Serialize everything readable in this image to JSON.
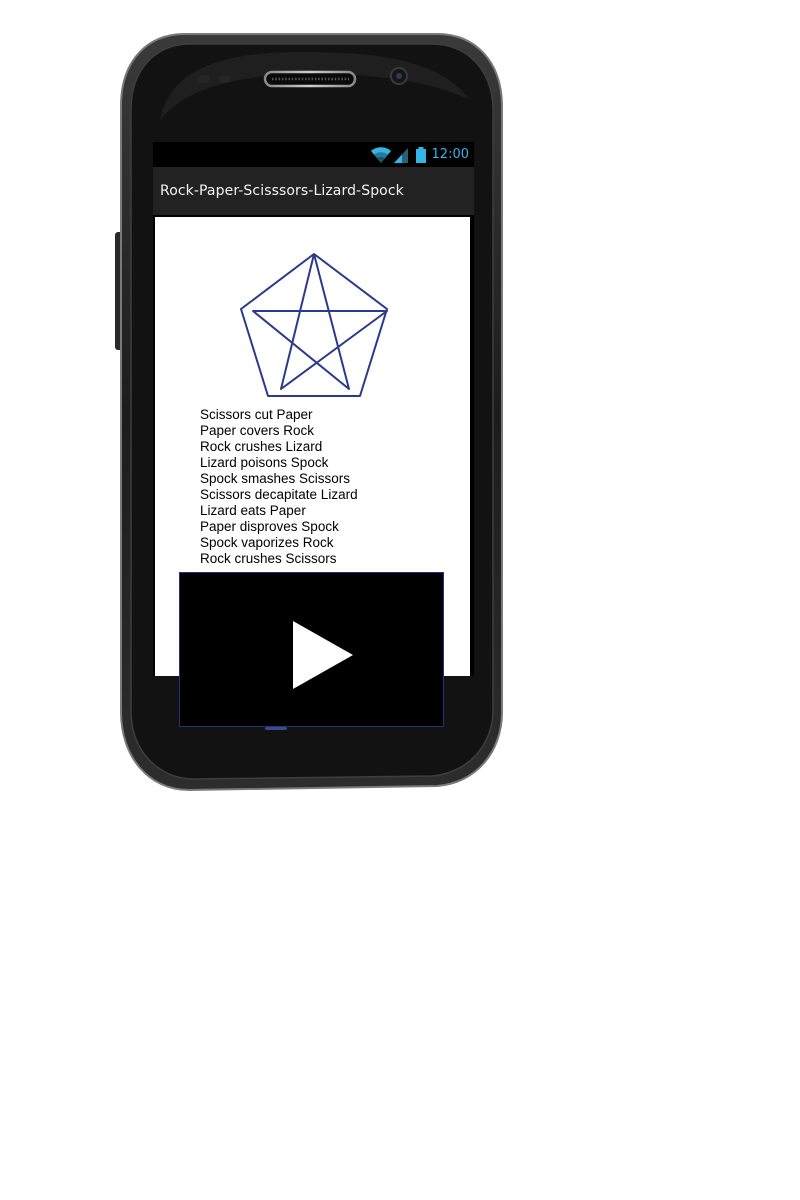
{
  "status_bar": {
    "time": "12:00",
    "icons": [
      "wifi-icon",
      "signal-icon",
      "battery-icon"
    ],
    "icon_color": "#33b5e5"
  },
  "action_bar": {
    "title": "Rock-Paper-Scisssors-Lizard-Spock",
    "background": "#222222"
  },
  "diagram": {
    "icon": "pentagram-diagram",
    "stroke_color": "#2a3a8c"
  },
  "rules": [
    "Scissors cut Paper",
    "Paper covers Rock",
    "Rock crushes Lizard",
    "Lizard poisons Spock",
    "Spock smashes Scissors",
    "Scissors decapitate Lizard",
    "Lizard eats Paper",
    "Paper disproves Spock",
    "Spock vaporizes Rock",
    "Rock crushes Scissors"
  ],
  "video_overlay": {
    "icon": "play-icon",
    "background": "#000000"
  },
  "device": {
    "icons": [
      "earpiece-speaker",
      "front-camera-icon",
      "proximity-sensor"
    ]
  }
}
